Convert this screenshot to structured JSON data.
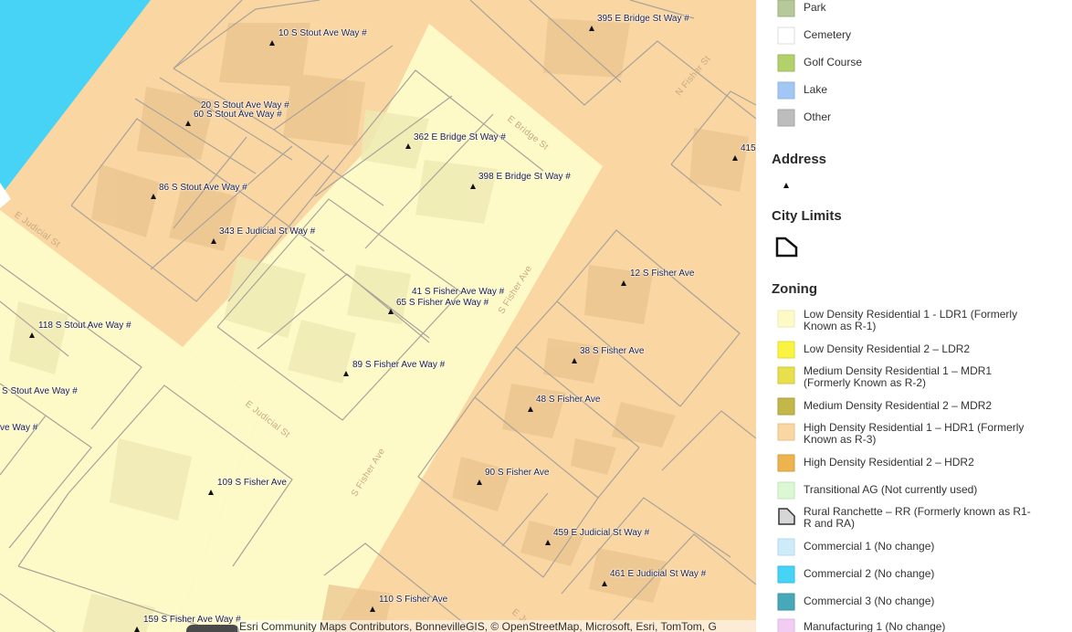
{
  "map": {
    "addresses": [
      {
        "label": "10 S Stout Ave Way #"
      },
      {
        "label": "20 S Stout Ave Way #"
      },
      {
        "label": "60 S Stout Ave Way #"
      },
      {
        "label": "86 S Stout Ave Way #"
      },
      {
        "label": "343 E Judicial St Way #"
      },
      {
        "label": "362 E Bridge St Way #"
      },
      {
        "label": "398 E Bridge St Way #"
      },
      {
        "label": "395 E Bridge St Way #"
      },
      {
        "label": "415"
      },
      {
        "label": "41 S Fisher Ave Way #"
      },
      {
        "label": "65 S Fisher Ave Way #"
      },
      {
        "label": "89 S Fisher Ave Way #"
      },
      {
        "label": "12 S Fisher Ave"
      },
      {
        "label": "38 S Fisher Ave"
      },
      {
        "label": "48 S Fisher Ave"
      },
      {
        "label": "90 S Fisher Ave"
      },
      {
        "label": "459 E Judicial St Way #"
      },
      {
        "label": "461 E Judicial St Way #"
      },
      {
        "label": "118 S Stout Ave Way #"
      },
      {
        "label": "S Stout Ave Way #"
      },
      {
        "label": "ve Way #"
      },
      {
        "label": "109 S Fisher Ave"
      },
      {
        "label": "110 S Fisher Ave"
      },
      {
        "label": "159 S Fisher Ave Way #"
      }
    ],
    "streets": [
      {
        "label": "E Bridge St"
      },
      {
        "label": "N Fisher St"
      },
      {
        "label": "E Judicial St"
      },
      {
        "label": "S Fisher Ave"
      },
      {
        "label": "E Judicial St"
      },
      {
        "label": "S Fisher Ave"
      },
      {
        "label": "E Ju"
      }
    ],
    "attribution": "Esri Community Maps Contributors, BonnevilleGIS, © OpenStreetMap, Microsoft, Esri, TomTom, G",
    "colors": {
      "hdr1": "#f9d6a2",
      "ldr1": "#fdfac8",
      "commercial2": "#46d3f5",
      "parcel_line": "#a9a39a",
      "building": "#ebc48f"
    }
  },
  "legend": {
    "top_items": [
      {
        "label": "Park",
        "color": "#b5c99a",
        "icon": "park-swatch-icon"
      },
      {
        "label": "Cemetery",
        "color": "#ffffff",
        "icon": "cemetery-swatch-icon"
      },
      {
        "label": "Golf Course",
        "color": "#b3d16a",
        "icon": "golf-course-swatch-icon"
      },
      {
        "label": "Lake",
        "color": "#a3c7f5",
        "icon": "lake-swatch-icon"
      },
      {
        "label": "Other",
        "color": "#bdbdbd",
        "icon": "other-swatch-icon"
      }
    ],
    "address_heading": "Address",
    "city_limits_heading": "City Limits",
    "zoning_heading": "Zoning",
    "zoning_items": [
      {
        "label": "Low Density Residential 1 - LDR1 (Formerly Known as R-1)",
        "color": "#fdfac8"
      },
      {
        "label": "Low Density Residential 2 – LDR2",
        "color": "#fbf342"
      },
      {
        "label": "Medium Density Residential 1 – MDR1 (Formerly Known as R-2)",
        "color": "#e7df4b"
      },
      {
        "label": "Medium Density Residential 2 – MDR2",
        "color": "#c3b74a"
      },
      {
        "label": "High Density Residential 1 – HDR1 (Formerly Known as R-3)",
        "color": "#f9d6a2"
      },
      {
        "label": "High Density Residential 2 – HDR2",
        "color": "#edb34f"
      },
      {
        "label": "Transitional AG (Not currently used)",
        "color": "#dcf7d4"
      },
      {
        "label": "Rural Ranchette – RR (Formerly known as R1-R and RA)",
        "color": "#d6d6d6"
      },
      {
        "label": "Commercial 1 (No change)",
        "color": "#cdebf9"
      },
      {
        "label": "Commercial 2 (No change)",
        "color": "#46d3f5"
      },
      {
        "label": "Commercial 3 (No change)",
        "color": "#48a8b9"
      },
      {
        "label": "Manufacturing 1 (No change)",
        "color": "#f2cdf3"
      }
    ]
  }
}
